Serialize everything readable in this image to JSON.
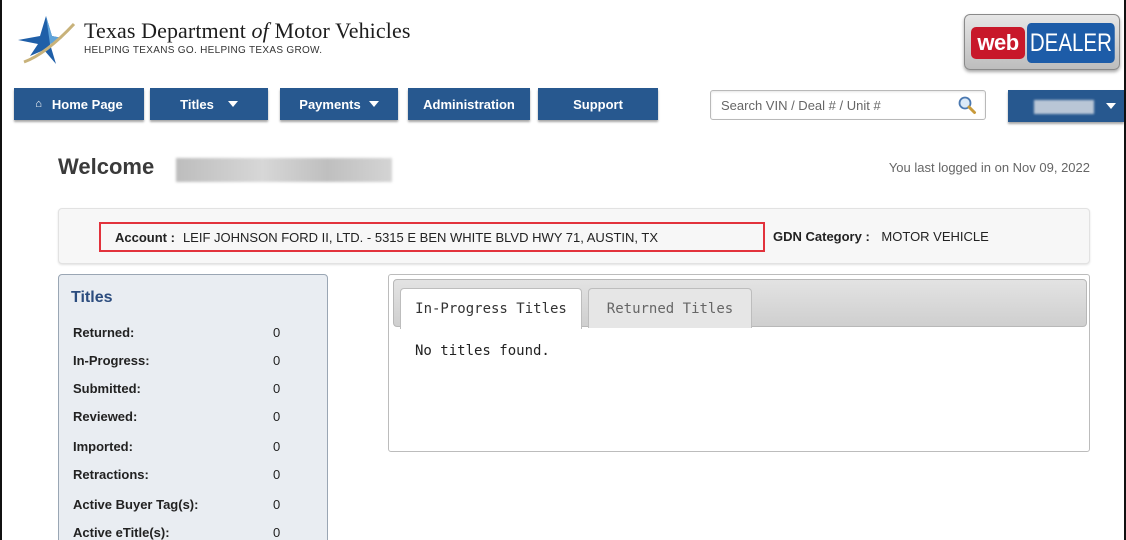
{
  "header": {
    "title_pre": "Texas Department ",
    "title_of": "of",
    "title_post": " Motor Vehicles",
    "tagline": "HELPING TEXANS GO. HELPING TEXAS GROW.",
    "badge_web": "web",
    "badge_dealer": "DEALER"
  },
  "nav": {
    "home": "Home Page",
    "home_icon_glyph": "⌂",
    "titles": "Titles",
    "payments": "Payments",
    "administration": "Administration",
    "support": "Support",
    "search_placeholder": "Search VIN / Deal # / Unit #"
  },
  "welcome": {
    "label": "Welcome",
    "last_login": "You last logged in on Nov 09, 2022"
  },
  "account": {
    "label": "Account :",
    "value": "LEIF JOHNSON FORD II, LTD. - 5315 E BEN WHITE BLVD HWY 71, AUSTIN, TX",
    "gdn_label": "GDN Category :",
    "gdn_value": "MOTOR VEHICLE"
  },
  "titles_summary": {
    "heading": "Titles",
    "rows": [
      {
        "label": "Returned:",
        "value": "0"
      },
      {
        "label": "In-Progress:",
        "value": "0"
      },
      {
        "label": "Submitted:",
        "value": "0"
      },
      {
        "label": "Reviewed:",
        "value": "0"
      },
      {
        "label": "Imported:",
        "value": "0"
      },
      {
        "label": "Retractions:",
        "value": "0"
      },
      {
        "label": "Active Buyer Tag(s):",
        "value": "0"
      },
      {
        "label": "Active eTitle(s):",
        "value": "0"
      }
    ]
  },
  "tabs": {
    "active": "In-Progress Titles",
    "inactive": "Returned Titles",
    "empty_message": "No titles found."
  },
  "colors": {
    "nav_blue": "#27588f",
    "highlight_red": "#e2323c",
    "titles_heading": "#2b4c7e"
  }
}
